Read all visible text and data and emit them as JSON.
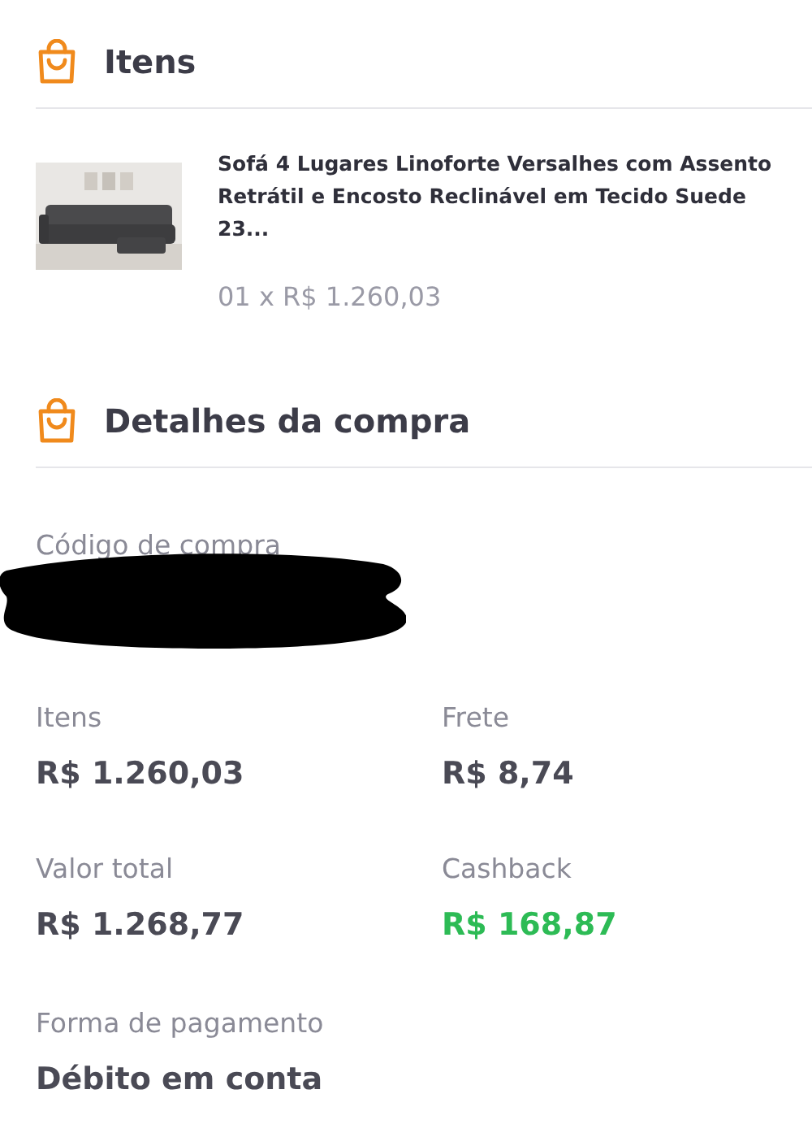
{
  "items_section": {
    "title": "Itens",
    "items": [
      {
        "kind": "picture",
        "name": "Sofá 4 Lugares Linoforte Versalhes com Assento Retrátil e Encosto Reclinável em Tecido Suede 23...",
        "quantity_price": "01 x R$ 1.260,03"
      }
    ]
  },
  "details_section": {
    "title": "Detalhes da compra",
    "purchase_code": {
      "label": "Código de compra",
      "redacted": true
    },
    "fields": [
      {
        "label": "Itens",
        "value": "R$ 1.260,03",
        "kind": "plain"
      },
      {
        "label": "Frete",
        "value": "R$ 8,74",
        "kind": "plain"
      },
      {
        "label": "Valor total",
        "value": "R$ 1.268,77",
        "kind": "plain"
      },
      {
        "label": "Cashback",
        "value": "R$ 168,87",
        "kind": "cashback"
      }
    ],
    "payment": {
      "label": "Forma de pagamento",
      "value": "Débito em conta"
    }
  }
}
